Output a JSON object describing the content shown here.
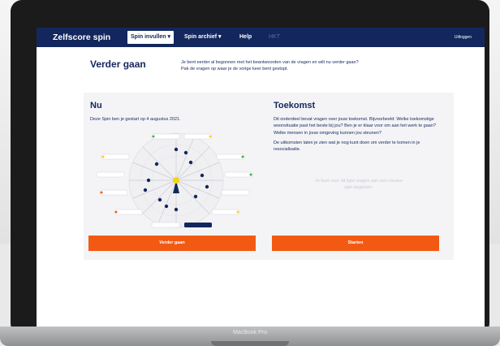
{
  "device": {
    "label": "MacBook Pro"
  },
  "nav": {
    "brand": "Zelfscore spin",
    "items": [
      {
        "label": "Spin invullen ▾",
        "active": true
      },
      {
        "label": "Spin archief ▾",
        "active": false
      },
      {
        "label": "Help",
        "active": false
      },
      {
        "label": "HKT",
        "active": false,
        "muted": true
      }
    ],
    "logout": "Uitloggen"
  },
  "intro": {
    "title": "Verder gaan",
    "line1": "Je bent eerder al begonnen met het beantwoorden van de vragen en wilt nu verder gaan?",
    "line2": "Pak de vragen op waar je de vorige keer bent gestopt."
  },
  "card_now": {
    "title": "Nu",
    "text": "Deze Spin ben je gestart op 4 augustus 2021.",
    "button": "Verder gaan"
  },
  "card_future": {
    "title": "Toekomst",
    "p1": "Dit onderdeel bevat vragen over jouw toekomst. Bijvoorbeeld: Welke toekomstige woonsituatie past het beste bij jou? Ben je er klaar voor om aan het werk te gaan? Welke mensen in jouw omgeving kunnen jou steunen?",
    "p2": "De uitkomsten laten je zien wat je nog kunt doen om verder te komen in je resocialisatie.",
    "placeholder": "Je kunt voor dit type vragen aan een nieuwe spin beginnen.",
    "button": "Starten"
  },
  "colors": {
    "navy": "#13275e",
    "orange": "#f25a14",
    "accent_green": "#37b34a",
    "accent_yellow": "#f5d417"
  }
}
